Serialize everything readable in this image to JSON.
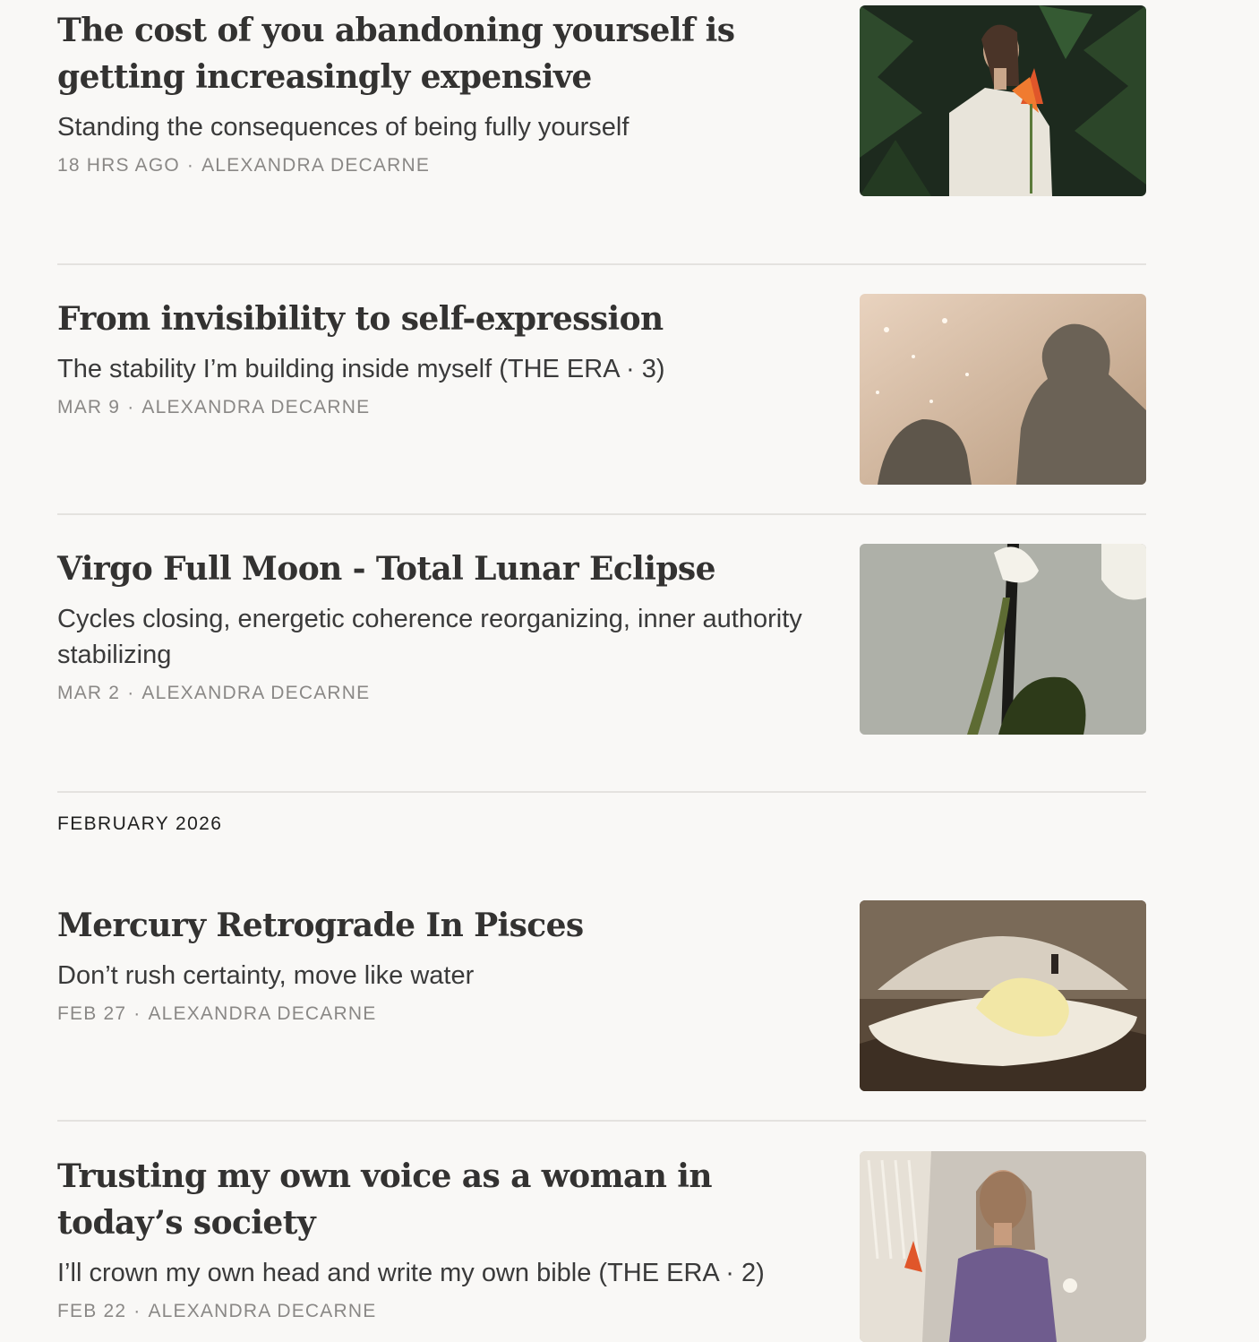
{
  "posts": [
    {
      "title": "The cost of you abandoning yourself is getting increasingly expensive",
      "subtitle": "Standing the consequences of being fully yourself",
      "date": "18 HRS AGO",
      "author": "ALEXANDRA DECARNE",
      "image": "woman-in-white-shirt-holding-orange-flowers-jungle"
    },
    {
      "title": "From invisibility to self-expression",
      "subtitle": "The stability I’m building inside myself (THE ERA · 3)",
      "date": "MAR 9",
      "author": "ALEXANDRA DECARNE",
      "image": "shadow-silhouette-over-sparkling-water"
    },
    {
      "title": "Virgo Full Moon - Total Lunar Eclipse",
      "subtitle": "Cycles closing, energetic coherence reorganizing, inner authority stabilizing",
      "date": "MAR 2",
      "author": "ALEXANDRA DECARNE",
      "image": "white-orchid-stem-on-grey-wall"
    },
    {
      "title": "Mercury Retrograde In Pisces",
      "subtitle": "Don’t rush certainty, move like water",
      "date": "FEB 27",
      "author": "ALEXANDRA DECARNE",
      "image": "scallop-shell-with-yellow-petal"
    },
    {
      "title": "Trusting my own voice as a woman in today’s society",
      "subtitle": "I’ll crown my own head and write my own bible (THE ERA · 2)",
      "date": "FEB 22",
      "author": "ALEXANDRA DECARNE",
      "image": "woman-in-purple-top-by-macrame-wall"
    }
  ],
  "section": {
    "heading": "FEBRUARY 2026"
  },
  "meta_separator": "·"
}
